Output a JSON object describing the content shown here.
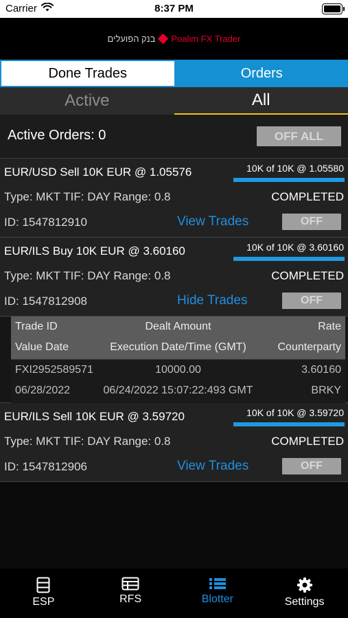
{
  "status_bar": {
    "carrier": "Carrier",
    "time": "8:37 PM"
  },
  "header": {
    "logo_hebrew": "בנק הפועלים",
    "logo_text": "Poalim FX Trader"
  },
  "segments": {
    "done_trades": "Done Trades",
    "orders": "Orders"
  },
  "subtabs": {
    "active": "Active",
    "all": "All"
  },
  "active_orders": {
    "label": "Active Orders: 0",
    "off_all": "OFF ALL"
  },
  "orders": [
    {
      "title": "EUR/USD Sell 10K EUR @ 1.05576",
      "fill_label": "10K of 10K @ 1.05580",
      "fill_fraction": 1.0,
      "type_line": "Type: MKT  TIF: DAY  Range: 0.8",
      "status": "COMPLETED",
      "id_line": "ID: 1547812910",
      "trades_link": "View Trades",
      "off": "OFF"
    },
    {
      "title": "EUR/ILS Buy 10K EUR @ 3.60160",
      "fill_label": "10K of 10K @ 3.60160",
      "fill_fraction": 1.0,
      "type_line": "Type: MKT  TIF: DAY  Range: 0.8",
      "status": "COMPLETED",
      "id_line": "ID: 1547812908",
      "trades_link": "Hide Trades",
      "off": "OFF"
    },
    {
      "title": "EUR/ILS Sell 10K EUR @ 3.59720",
      "fill_label": "10K of 10K @ 3.59720",
      "fill_fraction": 1.0,
      "type_line": "Type: MKT  TIF: DAY  Range: 0.8",
      "status": "COMPLETED",
      "id_line": "ID: 1547812906",
      "trades_link": "View Trades",
      "off": "OFF"
    }
  ],
  "trades_table": {
    "headers": {
      "trade_id": "Trade ID",
      "dealt_amount": "Dealt Amount",
      "rate": "Rate",
      "value_date": "Value Date",
      "execution": "Execution Date/Time (GMT)",
      "counterparty": "Counterparty"
    },
    "row": {
      "trade_id": "FXI2952589571",
      "dealt_amount": "10000.00",
      "rate": "3.60160",
      "value_date": "06/28/2022",
      "execution": "06/24/2022 15:07:22:493 GMT",
      "counterparty": "BRKY"
    }
  },
  "tabbar": {
    "esp": "ESP",
    "rfs": "RFS",
    "blotter": "Blotter",
    "settings": "Settings",
    "selected": "blotter"
  },
  "colors": {
    "accent_blue": "#1590d2",
    "brand_red": "#e4002b",
    "subtab_underline": "#f3c316"
  }
}
